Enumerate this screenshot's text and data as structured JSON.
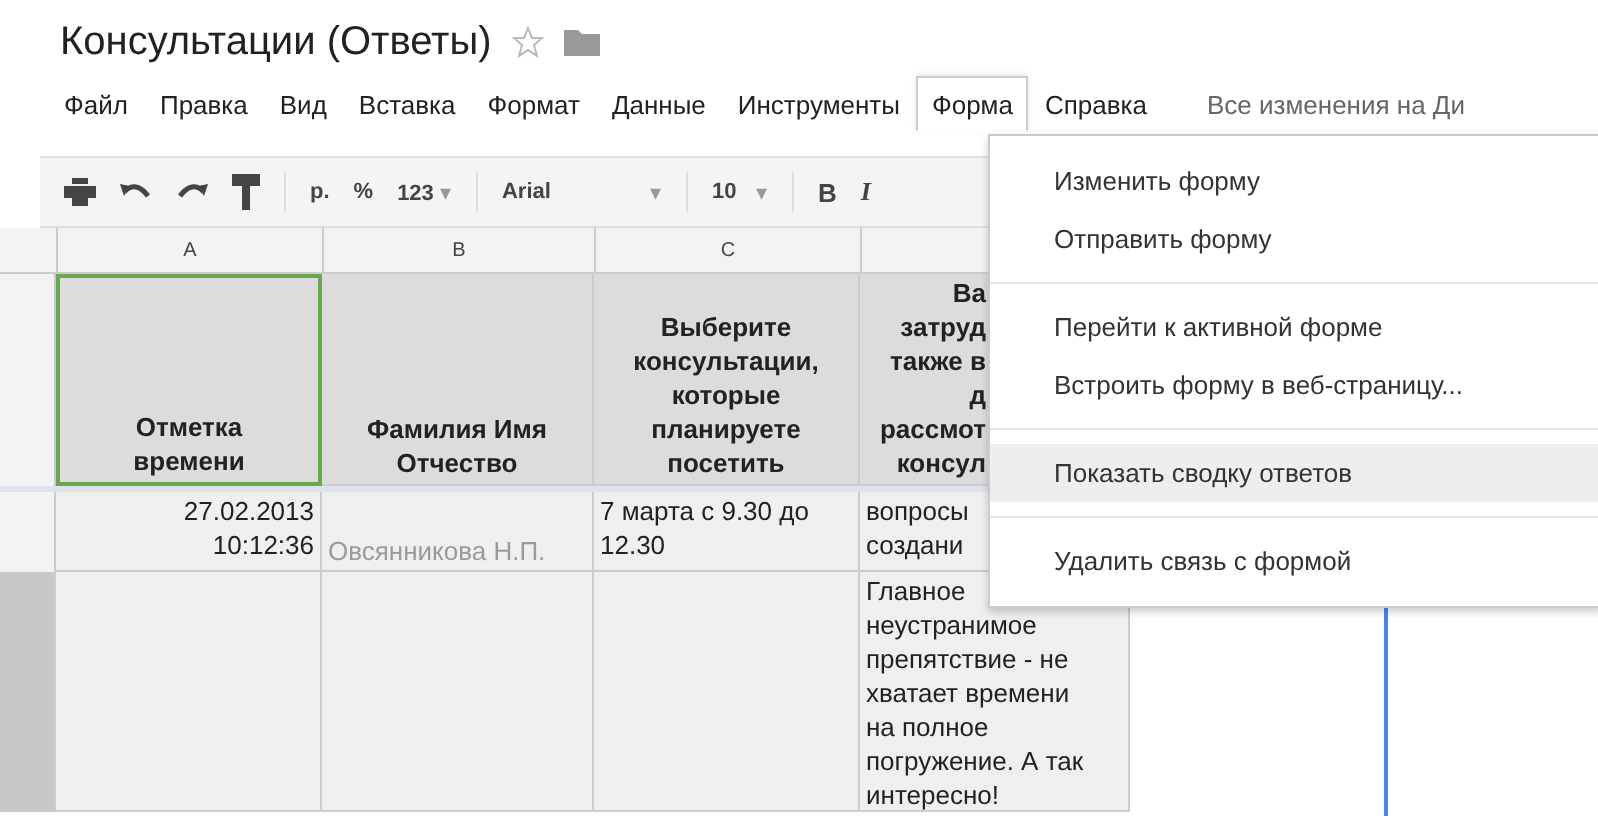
{
  "document": {
    "title": "Консультации (Ответы)",
    "starred": false
  },
  "menu_bar": {
    "items": [
      {
        "label": "Файл",
        "selected": false
      },
      {
        "label": "Правка",
        "selected": false
      },
      {
        "label": "Вид",
        "selected": false
      },
      {
        "label": "Вставка",
        "selected": false
      },
      {
        "label": "Формат",
        "selected": false
      },
      {
        "label": "Данные",
        "selected": false
      },
      {
        "label": "Инструменты",
        "selected": false
      },
      {
        "label": "Форма",
        "selected": true
      },
      {
        "label": "Справка",
        "selected": false
      }
    ],
    "status": "Все изменения на Ди"
  },
  "toolbar": {
    "currency": "р.",
    "percent": "%",
    "number_format": {
      "label": "123",
      "caret": "▾"
    },
    "font": {
      "label": "Arial",
      "caret": "▾"
    },
    "font_size": {
      "label": "10",
      "caret": "▾"
    },
    "bold": "B",
    "italic": "I"
  },
  "sheet": {
    "column_headers": [
      "A",
      "B",
      "C"
    ],
    "header_row": [
      {
        "lines": [
          "Отметка",
          "времени"
        ],
        "selected": true,
        "covered": false
      },
      {
        "lines": [
          "Фамилия Имя",
          "Отчество"
        ],
        "selected": false,
        "covered": false
      },
      {
        "lines": [
          "Выберите",
          "консультации,",
          "которые",
          "планируете",
          "посетить"
        ],
        "selected": false,
        "covered": false
      },
      {
        "lines": [
          "Ва",
          "затруд",
          "также в",
          "д",
          "рассмот",
          "консул"
        ],
        "selected": false,
        "covered": true
      }
    ],
    "rows": [
      {
        "cells": [
          {
            "lines": [
              "27.02.2013",
              "10:12:36"
            ],
            "kind": "date"
          },
          {
            "lines": [
              "Овсянникова Н.П."
            ],
            "kind": "hint"
          },
          {
            "lines": [
              "7  марта с 9.30 до",
              "12.30"
            ],
            "kind": "text"
          },
          {
            "lines": [
              "вопросы",
              "создани"
            ],
            "kind": "text"
          }
        ]
      },
      {
        "cells": [
          {},
          {},
          {},
          {
            "lines": [
              "Главное",
              "неустранимое",
              "препятствие - не",
              "хватает времени",
              "на полное",
              "погружение. А так",
              "интересно!"
            ],
            "kind": "text"
          }
        ]
      }
    ]
  },
  "form_menu": {
    "groups": [
      [
        {
          "label": "Изменить форму",
          "selected": false
        },
        {
          "label": "Отправить форму",
          "selected": false
        }
      ],
      [
        {
          "label": "Перейти к активной форме",
          "selected": false
        },
        {
          "label": "Встроить форму в веб-страницу...",
          "selected": false
        }
      ],
      [
        {
          "label": "Показать сводку ответов",
          "selected": true
        }
      ],
      [
        {
          "label": "Удалить связь с формой",
          "selected": false
        }
      ]
    ]
  }
}
